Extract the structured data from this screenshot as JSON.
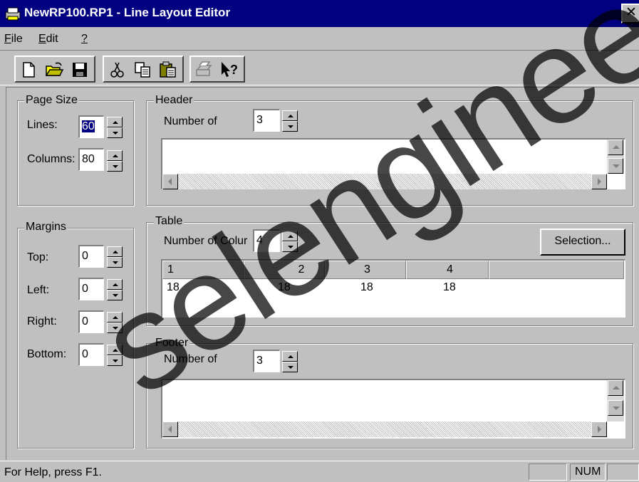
{
  "window": {
    "title": "NewRP100.RP1 - Line Layout Editor",
    "close_glyph": "✕"
  },
  "menu": [
    {
      "label": "File",
      "key": "F",
      "rest": "ile"
    },
    {
      "label": "Edit",
      "key": "E",
      "rest": "dit"
    },
    {
      "label": "?",
      "key": "?",
      "rest": ""
    }
  ],
  "toolbar": {
    "icons": [
      "new-file-icon",
      "open-folder-icon",
      "save-icon",
      "cut-icon",
      "copy-icon",
      "paste-icon",
      "print-icon",
      "context-help-icon"
    ]
  },
  "page_size": {
    "title": "Page Size",
    "lines_label": "Lines:",
    "lines_value": "60",
    "columns_label": "Columns:",
    "columns_value": "80"
  },
  "margins": {
    "title": "Margins",
    "top_label": "Top:",
    "top_value": "0",
    "left_label": "Left:",
    "left_value": "0",
    "right_label": "Right:",
    "right_value": "0",
    "bottom_label": "Bottom:",
    "bottom_value": "0"
  },
  "header": {
    "title": "Header",
    "number_label": "Number of",
    "number_value": "3"
  },
  "table": {
    "title": "Table",
    "number_label": "Number of Colur",
    "number_value": "4",
    "selection_button": "Selection...",
    "columns": [
      "1",
      "2",
      "3",
      "4"
    ],
    "row": [
      "18",
      "18",
      "18",
      "18"
    ]
  },
  "footer": {
    "title": "Footer",
    "number_label": "Number of",
    "number_value": "3"
  },
  "status": {
    "help_text": "For Help, press F1.",
    "num": "NUM"
  },
  "watermark": "selengineers"
}
